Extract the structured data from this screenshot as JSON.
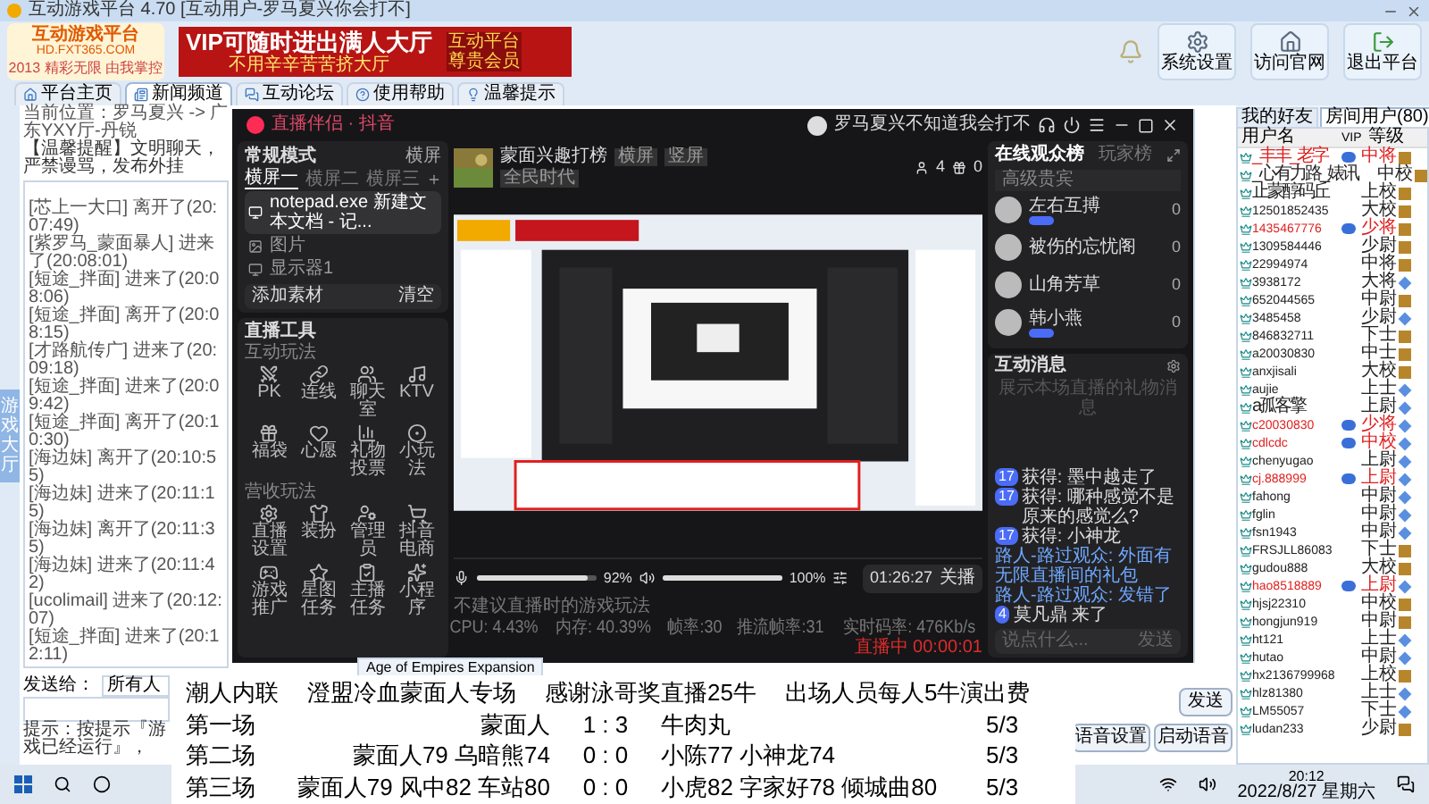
{
  "window": {
    "title": "互动游戏平台 4.70 [互动用户-罗马夏兴你会打不]"
  },
  "header": {
    "logo_name": "互动游戏平台",
    "logo_url": "HD.FXT365.COM",
    "logo_slogan": "2013 精彩无限 由我掌控",
    "banner_title": "VIP可随时进出满人大厅",
    "banner_subtitle": "不用辛辛苦苦挤大厅",
    "banner_badge": "互动平台尊贵会员",
    "buttons": [
      "系统设置",
      "访问官网",
      "退出平台"
    ]
  },
  "nav_tabs": [
    {
      "label": "平台主页",
      "selected": false
    },
    {
      "label": "新闻频道",
      "selected": true
    },
    {
      "label": "互动论坛",
      "selected": false
    },
    {
      "label": "使用帮助",
      "selected": false
    },
    {
      "label": "温馨提示",
      "selected": false
    }
  ],
  "side_tab": "游戏大厅",
  "location": "当前位置：罗马夏兴 -> 广东YXY厅-丹锐",
  "notice": "【温馨提醒】文明聊天，严禁谩骂，发布外挂",
  "chat_log": [
    "[芯上一大口] 离开了(20:07:49)",
    "[紫罗马_蒙面暴人] 进来了(20:08:01)",
    "[短途_拌面] 进来了(20:08:06)",
    "[短途_拌面] 离开了(20:08:15)",
    "[才路航传广] 进来了(20:09:18)",
    "[短途_拌面] 进来了(20:09:42)",
    "[短途_拌面] 离开了(20:10:30)",
    "[海边妹] 离开了(20:10:55)",
    "[海边妹] 进来了(20:11:15)",
    "[海边妹] 离开了(20:11:35)",
    "[海边妹] 进来了(20:11:42)",
    "[ucolimail] 进来了(20:12:07)",
    "[短途_拌面] 进来了(20:12:11)"
  ],
  "send_to": {
    "label": "发送给：",
    "value": "所有人"
  },
  "tip": "提示：按提示『游戏已经运行』，",
  "room_buttons": [
    "发送",
    "语音设置",
    "启动语音"
  ],
  "live_app": {
    "title": "直播伴侣 · 抖音",
    "account": "罗马夏兴不知道我会打不",
    "mode": "常规模式",
    "layout_label": "横屏",
    "scenes": [
      {
        "label": "横屏一",
        "selected": true
      },
      {
        "label": "横屏二",
        "selected": false
      },
      {
        "label": "横屏三",
        "selected": false
      }
    ],
    "sources": [
      {
        "label": "notepad.exe 新建文本文档 - 记...",
        "selected": true
      },
      {
        "label": "图片",
        "selected": false
      },
      {
        "label": "显示器1",
        "selected": false
      }
    ],
    "add_source": "添加素材",
    "clear": "清空",
    "tools_title": "直播工具",
    "tool_groups": [
      {
        "title": "互动玩法",
        "tools": [
          "PK",
          "连线",
          "聊天室",
          "KTV",
          "福袋",
          "心愿",
          "礼物投票",
          "小玩法"
        ]
      },
      {
        "title": "营收玩法",
        "tools": [
          "直播设置",
          "装扮",
          "管理员",
          "抖音电商",
          "游戏推广",
          "星图任务",
          "主播任务",
          "小程序"
        ]
      }
    ],
    "stream_title": "蒙面兴趣打榜",
    "stream_tags": [
      "横屏",
      "竖屏"
    ],
    "stream_badge": "全民时代",
    "viewers_count": "4",
    "gifts_count": "0",
    "mic": {
      "level": 0.92,
      "reading": "92%"
    },
    "speaker": {
      "level": 1.0,
      "reading": "100%"
    },
    "timer": "01:26:27",
    "stop_button": "关播",
    "hint": "不建议直播时的游戏玩法",
    "stats": [
      "CPU: 4.43%",
      "内存: 40.39%",
      "帧率:30",
      "推流帧率:31",
      "实时码率: 476Kb/s"
    ],
    "live_status": "直播中 00:00:01",
    "audience_tabs": [
      {
        "label": "在线观众榜",
        "selected": true
      },
      {
        "label": "玩家榜",
        "selected": false
      }
    ],
    "audience_section": "高级贵宾",
    "viewers": [
      {
        "name": "左右互搏",
        "badge": true,
        "score": "0"
      },
      {
        "name": "被伤的忘忧阁",
        "badge": false,
        "score": "0"
      },
      {
        "name": "山角芳草",
        "badge": false,
        "score": "0"
      },
      {
        "name": "韩小燕",
        "badge": true,
        "score": "0"
      }
    ],
    "messages_title": "互动消息",
    "messages_placeholder": "展示本场直播的礼物消息",
    "messages": [
      {
        "kind": "user",
        "tag": "17",
        "text": "获得: 墨中越走了"
      },
      {
        "kind": "user",
        "tag": "17",
        "text": "获得: 哪种感觉不是原来的感觉么?"
      },
      {
        "kind": "user",
        "tag": "17",
        "text": "获得: 小神龙"
      },
      {
        "kind": "system",
        "text": "路人-路过观众: 外面有无限直播间的礼包"
      },
      {
        "kind": "system",
        "text": "路人-路过观众: 发错了"
      },
      {
        "kind": "user",
        "tag": "4",
        "text": "莫凡鼎 来了"
      }
    ],
    "input_placeholder": "说点什么...",
    "send": "发送"
  },
  "user_list": {
    "tabs": [
      {
        "label": "我的好友",
        "selected": false
      },
      {
        "label": "房间用户(80)",
        "selected": true
      }
    ],
    "columns": [
      "用户名",
      "VIP",
      "等级"
    ],
    "users": [
      {
        "name": "_丰丰_老字",
        "rank": "中将",
        "vip": true,
        "kind": "gold"
      },
      {
        "name": "_心有力路_婊讯",
        "rank": "中校",
        "vip": false,
        "kind": "gold"
      },
      {
        "name": "止蒙醇码丘",
        "rank": "上校",
        "vip": false,
        "kind": "gold"
      },
      {
        "name": "12501852435",
        "rank": "大校",
        "vip": false,
        "kind": "gold"
      },
      {
        "name": "1435467776",
        "rank": "少将",
        "vip": true,
        "kind": "gold"
      },
      {
        "name": "1309584446",
        "rank": "少尉",
        "vip": false,
        "kind": "gold"
      },
      {
        "name": "22994974",
        "rank": "中将",
        "vip": false,
        "kind": "gold"
      },
      {
        "name": "3938172",
        "rank": "大将",
        "vip": false,
        "kind": "blue"
      },
      {
        "name": "652044565",
        "rank": "中尉",
        "vip": false,
        "kind": "gold"
      },
      {
        "name": "3485458",
        "rank": "少尉",
        "vip": false,
        "kind": "blue"
      },
      {
        "name": "846832711",
        "rank": "下士",
        "vip": false,
        "kind": "gold"
      },
      {
        "name": "a20030830",
        "rank": "中士",
        "vip": false,
        "kind": "gold"
      },
      {
        "name": "anxjisali",
        "rank": "大校",
        "vip": false,
        "kind": "gold"
      },
      {
        "name": "aujie",
        "rank": "上士",
        "vip": false,
        "kind": "blue"
      },
      {
        "name": "a孤客擎",
        "rank": "上尉",
        "vip": false,
        "kind": "blue"
      },
      {
        "name": "c20030830",
        "rank": "少将",
        "vip": true,
        "kind": "blue"
      },
      {
        "name": "cdlcdc",
        "rank": "中校",
        "vip": true,
        "kind": "blue"
      },
      {
        "name": "chenyugao",
        "rank": "上尉",
        "vip": false,
        "kind": "blue"
      },
      {
        "name": "cj.888999",
        "rank": "上尉",
        "vip": true,
        "kind": "blue"
      },
      {
        "name": "fahong",
        "rank": "中尉",
        "vip": false,
        "kind": "blue"
      },
      {
        "name": "fglin",
        "rank": "中尉",
        "vip": false,
        "kind": "blue"
      },
      {
        "name": "fsn1943",
        "rank": "中尉",
        "vip": false,
        "kind": "blue"
      },
      {
        "name": "FRSJLL86083",
        "rank": "下士",
        "vip": false,
        "kind": "gold"
      },
      {
        "name": "gudou888",
        "rank": "大校",
        "vip": false,
        "kind": "gold"
      },
      {
        "name": "hao8518889",
        "rank": "上尉",
        "vip": true,
        "kind": "blue"
      },
      {
        "name": "hjsj22310",
        "rank": "中校",
        "vip": false,
        "kind": "gold"
      },
      {
        "name": "hongjun919",
        "rank": "中尉",
        "vip": false,
        "kind": "gold"
      },
      {
        "name": "ht121",
        "rank": "上士",
        "vip": false,
        "kind": "blue"
      },
      {
        "name": "hutao",
        "rank": "中尉",
        "vip": false,
        "kind": "blue"
      },
      {
        "name": "hx2136799968",
        "rank": "上校",
        "vip": false,
        "kind": "gold"
      },
      {
        "name": "hlz81380",
        "rank": "上士",
        "vip": false,
        "kind": "blue"
      },
      {
        "name": "LM55057",
        "rank": "下士",
        "vip": false,
        "kind": "blue"
      },
      {
        "name": "ludan233",
        "rank": "少尉",
        "vip": false,
        "kind": "gold"
      }
    ]
  },
  "overlay": {
    "header": [
      "潮人内联",
      "澄盟冷血蒙面人专场",
      "感谢泳哥奖直播25牛",
      "出场人员每人5牛演出费"
    ],
    "matches": [
      {
        "label": "第一场",
        "home": "蒙面人",
        "score": "1 : 3",
        "away": "牛肉丸",
        "points": "5/3"
      },
      {
        "label": "第二场",
        "home": "蒙面人79  乌暗熊74",
        "score": "0 : 0",
        "away": "小陈77  小神龙74",
        "points": "5/3"
      },
      {
        "label": "第三场",
        "home": "蒙面人79  风中82  车站80",
        "score": "0 : 0",
        "away": "小虎82  字家好78  倾城曲80",
        "points": "5/3"
      }
    ]
  },
  "taskbar_app": "Age of Empires Expansion",
  "clock": {
    "time": "20:12",
    "date": "2022/8/27 星期六"
  }
}
